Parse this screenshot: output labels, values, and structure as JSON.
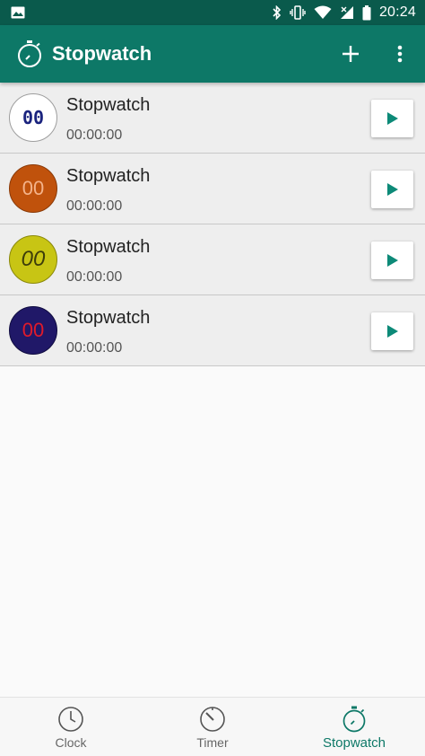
{
  "status_bar": {
    "time": "20:24",
    "icons": [
      "gallery-icon",
      "bluetooth-icon",
      "vibrate-icon",
      "wifi-icon",
      "signal-icon",
      "battery-icon"
    ]
  },
  "app_bar": {
    "title": "Stopwatch",
    "icon": "stopwatch-icon",
    "actions": [
      "add-icon",
      "more-vert-icon"
    ]
  },
  "stopwatches": [
    {
      "name": "Stopwatch",
      "time": "00:00:00",
      "badge_text": "00",
      "badge_bg": "#ffffff",
      "badge_fg": "#1a237e",
      "badge_border": "#9e9e9e"
    },
    {
      "name": "Stopwatch",
      "time": "00:00:00",
      "badge_text": "00",
      "badge_bg": "#c0520c",
      "badge_fg": "#f4b38a",
      "badge_border": "#8a3a08"
    },
    {
      "name": "Stopwatch",
      "time": "00:00:00",
      "badge_text": "00",
      "badge_bg": "#c8c514",
      "badge_fg": "#3d3d0a",
      "badge_border": "#8a880a"
    },
    {
      "name": "Stopwatch",
      "time": "00:00:00",
      "badge_text": "00",
      "badge_bg": "#201868",
      "badge_fg": "#e01a2a",
      "badge_border": "#100c40"
    }
  ],
  "bottom_nav": {
    "items": [
      {
        "label": "Clock",
        "icon": "clock-icon",
        "active": false
      },
      {
        "label": "Timer",
        "icon": "timer-icon",
        "active": false
      },
      {
        "label": "Stopwatch",
        "icon": "stopwatch-icon",
        "active": true
      }
    ]
  },
  "colors": {
    "primary": "#0d7867",
    "primary_dark": "#0a5a4c",
    "play": "#0d8a78"
  }
}
